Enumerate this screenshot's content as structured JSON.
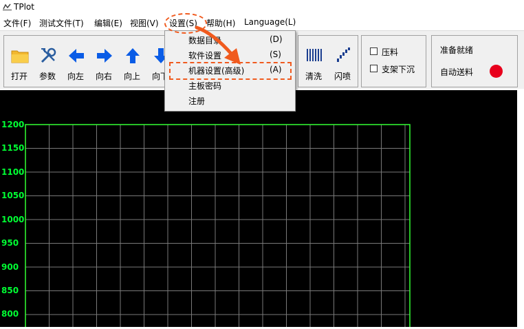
{
  "window": {
    "title": "TPlot"
  },
  "menubar": {
    "items": [
      {
        "label": "文件(F)"
      },
      {
        "label": "测试文件(T)"
      },
      {
        "label": "编辑(E)"
      },
      {
        "label": "视图(V)"
      },
      {
        "label": "设置(S)"
      },
      {
        "label": "帮助(H)"
      },
      {
        "label": "Language(L)"
      }
    ]
  },
  "toolbar": {
    "buttons": [
      {
        "label": "打开",
        "icon": "folder-icon"
      },
      {
        "label": "参数",
        "icon": "tools-icon"
      },
      {
        "label": "向左",
        "icon": "arrow-left-icon"
      },
      {
        "label": "向右",
        "icon": "arrow-right-icon"
      },
      {
        "label": "向上",
        "icon": "arrow-up-icon"
      },
      {
        "label": "向下",
        "icon": "arrow-down-icon"
      },
      {
        "label": "清洗",
        "icon": "barcode-icon"
      },
      {
        "label": "闪喷",
        "icon": "spray-icon"
      }
    ],
    "checkboxes": [
      {
        "label": "压料",
        "checked": false
      },
      {
        "label": "支架下沉",
        "checked": false
      }
    ],
    "status_text": "准备就绪",
    "auto_feed_label": "自动送料",
    "indicator_color": "#e8001c"
  },
  "settings_menu": {
    "items": [
      {
        "label": "数据目录",
        "shortcut": "(D)"
      },
      {
        "label": "软件设置",
        "shortcut": "(S)"
      },
      {
        "label": "机器设置(高级)",
        "shortcut": "(A)"
      },
      {
        "label": "主板密码",
        "shortcut": ""
      },
      {
        "label": "注册",
        "shortcut": ""
      }
    ]
  },
  "plot": {
    "y_ticks": [
      "1200",
      "1150",
      "1100",
      "1050",
      "1000",
      "950",
      "900",
      "850",
      "800"
    ],
    "axis_color": "#33ff33",
    "grid_color": "#7a7a7a",
    "background": "#000000"
  },
  "annotation": {
    "color": "#f05a1e"
  }
}
